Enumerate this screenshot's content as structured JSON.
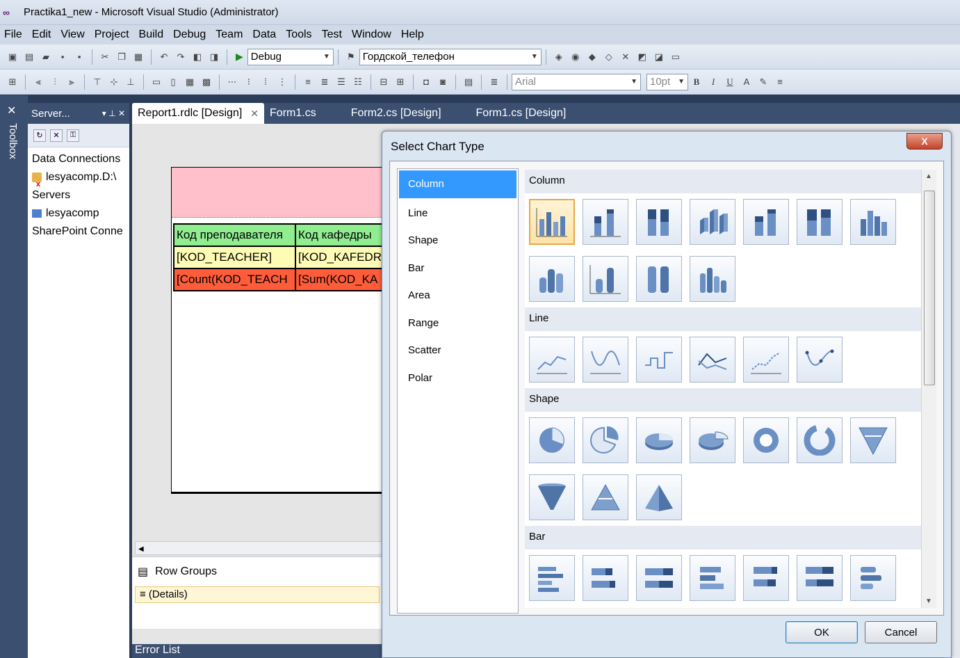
{
  "window": {
    "title": "Practika1_new - Microsoft Visual Studio (Administrator)"
  },
  "menu": [
    "File",
    "Edit",
    "View",
    "Project",
    "Build",
    "Debug",
    "Team",
    "Data",
    "Tools",
    "Test",
    "Window",
    "Help"
  ],
  "toolbar": {
    "config": "Debug",
    "find_value": "Гордской_телефон",
    "font_name": "Arial",
    "font_size": "10pt"
  },
  "toolbox_label": "Toolbox",
  "server_explorer": {
    "title": "Server...",
    "items": [
      "Data Connections",
      "lesyacomp.D:\\",
      "Servers",
      "lesyacomp",
      "SharePoint Conne"
    ]
  },
  "tabs": [
    {
      "label": "Report1.rdlc [Design]",
      "active": true
    },
    {
      "label": "Form1.cs",
      "active": false
    },
    {
      "label": "Form2.cs [Design]",
      "active": false
    },
    {
      "label": "Form1.cs [Design]",
      "active": false
    }
  ],
  "report": {
    "header_row": [
      "Код преподавателя",
      "Код кафедры"
    ],
    "detail_row": [
      "[KOD_TEACHER]",
      "[KOD_KAFEDR"
    ],
    "total_row": [
      "[Count(KOD_TEACH",
      "[Sum(KOD_KA"
    ]
  },
  "row_groups": {
    "title": "Row Groups",
    "item": "≡ (Details)"
  },
  "error_list": "Error List",
  "dialog": {
    "title": "Select Chart Type",
    "categories": [
      "Column",
      "Line",
      "Shape",
      "Bar",
      "Area",
      "Range",
      "Scatter",
      "Polar"
    ],
    "selected_category": "Column",
    "sections": [
      "Column",
      "Line",
      "Shape",
      "Bar"
    ],
    "ok": "OK",
    "cancel": "Cancel",
    "close": "X"
  }
}
